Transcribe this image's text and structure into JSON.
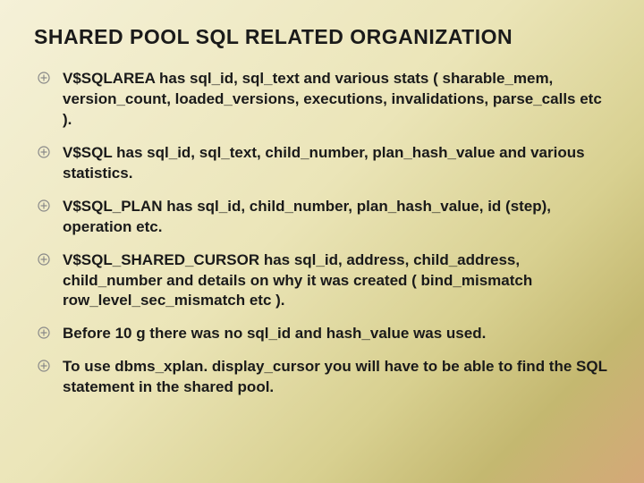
{
  "title": "SHARED POOL SQL RELATED ORGANIZATION",
  "bullets": [
    {
      "text": "V$SQLAREA has sql_id, sql_text and various stats ( sharable_mem, version_count, loaded_versions, executions, invalidations, parse_calls etc )."
    },
    {
      "text": "V$SQL has sql_id, sql_text, child_number, plan_hash_value and various statistics."
    },
    {
      "text": "V$SQL_PLAN has sql_id, child_number, plan_hash_value, id (step), operation etc."
    },
    {
      "text": "V$SQL_SHARED_CURSOR has sql_id, address, child_address, child_number and details on why it was created ( bind_mismatch row_level_sec_mismatch etc )."
    },
    {
      "text": "Before 10 g there was no sql_id and hash_value was used."
    },
    {
      "text": "To use dbms_xplan. display_cursor you will have to be able to find the SQL statement in the shared pool."
    }
  ]
}
